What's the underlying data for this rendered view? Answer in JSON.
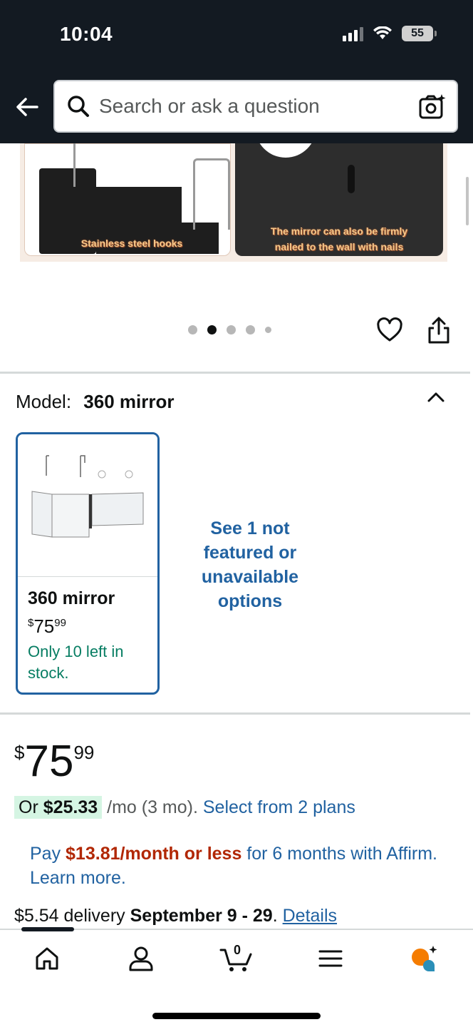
{
  "status_bar": {
    "time": "10:04",
    "battery": "55"
  },
  "search": {
    "placeholder": "Search or ask a question"
  },
  "gallery": {
    "caption_left": "Stainless steel hooks",
    "caption_right_line1": "The mirror can also be firmly",
    "caption_right_line2": "nailed to the wall with nails",
    "dot_count": 5,
    "active_dot": 1
  },
  "model": {
    "label": "Model:",
    "value": "360 mirror"
  },
  "variant": {
    "title": "360 mirror",
    "price_currency": "$",
    "price_whole": "75",
    "price_cents": "99",
    "stock": "Only 10 left in stock."
  },
  "see_options": "See 1 not featured or unavailable options",
  "price": {
    "currency": "$",
    "whole": "75",
    "cents": "99"
  },
  "installment": {
    "prefix": "Or ",
    "amount": "$25.33",
    "suffix": " /mo (3 mo). ",
    "link": "Select from 2 plans"
  },
  "affirm": {
    "prefix": "Pay ",
    "amount": "$13.81/month or less",
    "suffix": " for 6 months with Affirm. Learn more."
  },
  "delivery": {
    "cost": "$5.54 delivery ",
    "dates": "September 9 - 29",
    "sep": ". ",
    "link": "Details"
  },
  "bottom_nav": {
    "cart_count": "0"
  },
  "colors": {
    "header": "#131a22",
    "link": "#2162a1",
    "stock": "#067d62",
    "deal": "#b12704",
    "highlight": "#d5f5e3",
    "selected_border": "#2162a1"
  }
}
